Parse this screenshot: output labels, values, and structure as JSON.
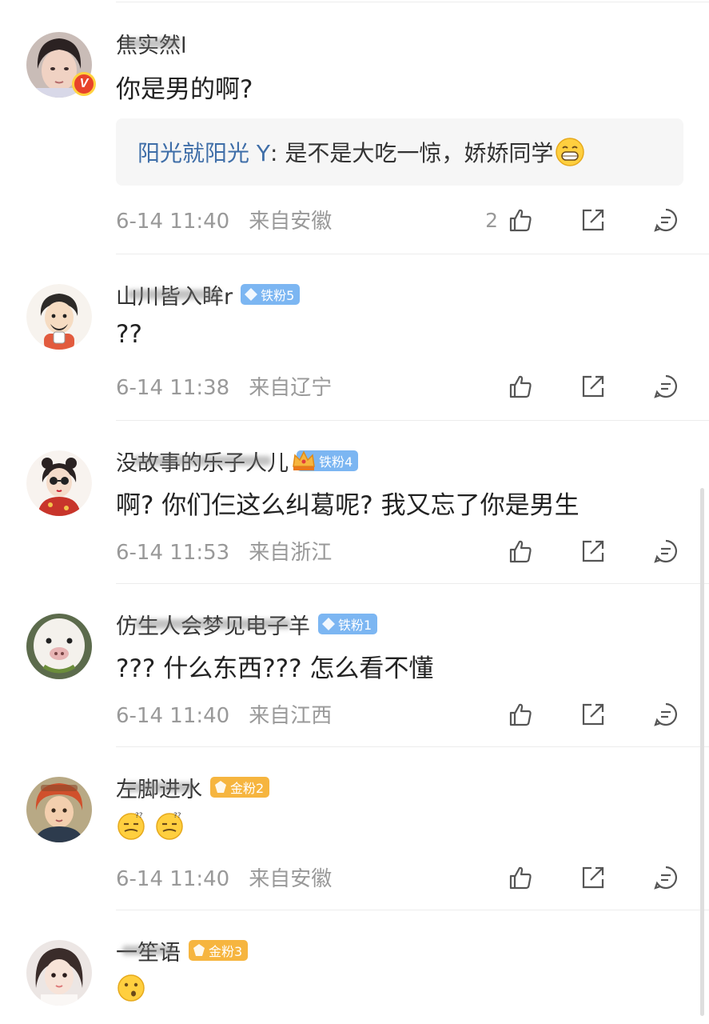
{
  "comments": [
    {
      "username": "焦实然l",
      "content": "你是男的啊?",
      "verified_badge": "V",
      "reply": {
        "name": "阳光就阳光 Y",
        "text": ": 是不是大吃一惊，娇娇同学"
      },
      "date": "6-14 11:40",
      "location": "来自安徽",
      "likes": "2"
    },
    {
      "username": "山川皆入眸r",
      "badge": "铁粉5",
      "content": "??",
      "date": "6-14 11:38",
      "location": "来自辽宁"
    },
    {
      "username": "没故事的乐子人儿",
      "badge": "铁粉4",
      "content": "啊? 你们仨这么纠葛呢? 我又忘了你是男生",
      "date": "6-14 11:53",
      "location": "来自浙江"
    },
    {
      "username": "仿生人会梦见电子羊",
      "badge": "铁粉1",
      "content": "??? 什么东西??? 怎么看不懂",
      "date": "6-14 11:40",
      "location": "来自江西"
    },
    {
      "username": "左脚进水",
      "badge": "金粉2",
      "content": "",
      "date": "6-14 11:40",
      "location": "来自安徽"
    },
    {
      "username": "一笙语",
      "badge": "金粉3",
      "content": ""
    }
  ],
  "icons": {
    "like": "thumbs-up-icon",
    "share": "share-icon",
    "comment": "comment-icon",
    "emoji_grin": "grinning-emoji",
    "emoji_confused": "confused-emoji",
    "emoji_surprised": "surprised-emoji"
  },
  "colors": {
    "reply_name": "#3f6ea8",
    "iron_badge": "#7cb6f2",
    "gold_badge": "#f6b53f",
    "meta_text": "#999999",
    "verified": "#e8432a"
  }
}
